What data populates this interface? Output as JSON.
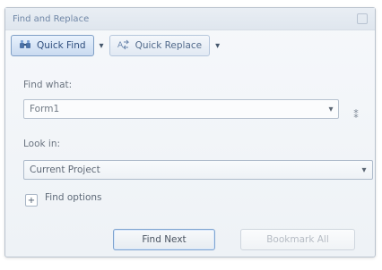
{
  "window": {
    "title": "Find and Replace"
  },
  "toolbar": {
    "quick_find_label": "Quick Find",
    "quick_replace_label": "Quick Replace"
  },
  "find": {
    "label": "Find what:",
    "value": "Form1"
  },
  "look_in": {
    "label": "Look in:",
    "value": "Current Project"
  },
  "options": {
    "label": "Find options"
  },
  "buttons": {
    "find_next": "Find Next",
    "bookmark_all": "Bookmark All"
  }
}
